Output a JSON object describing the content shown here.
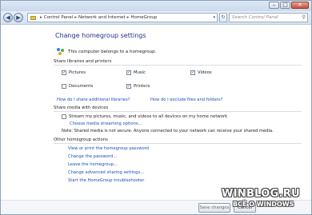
{
  "window": {
    "controls": {
      "minimize": "–",
      "maximize": "□",
      "close": "✕"
    }
  },
  "nav": {
    "back_icon": "back-arrow-icon",
    "forward_icon": "forward-arrow-icon",
    "breadcrumb": [
      "Control Panel",
      "Network and Internet",
      "HomeGroup"
    ],
    "search_placeholder": "Search Control Panel"
  },
  "page": {
    "title": "Change homegroup settings",
    "belongs_text": "This computer belongs to a homegroup."
  },
  "libraries": {
    "header": "Share libraries and printers",
    "items": [
      {
        "label": "Pictures",
        "checked": true
      },
      {
        "label": "Music",
        "checked": true
      },
      {
        "label": "Videos",
        "checked": true
      },
      {
        "label": "Documents",
        "checked": false
      },
      {
        "label": "Printers",
        "checked": true
      }
    ],
    "link_other_files": "How do I share additional libraries?",
    "link_exclude": "How do I exclude files and folders?"
  },
  "media": {
    "header": "Share media with devices",
    "stream_label": "Stream my pictures, music, and videos to all devices on my home network",
    "stream_checked": false,
    "choose_link": "Choose media streaming options...",
    "note": "Note: Shared media is not secure. Anyone connected to your network can receive your shared media."
  },
  "actions": {
    "header": "Other homegroup actions",
    "links": [
      "View or print the homegroup password",
      "Change the password...",
      "Leave the homegroup...",
      "Change advanced sharing settings...",
      "Start the HomeGroup troubleshooter"
    ]
  },
  "buttons": {
    "save": "Save changes",
    "cancel": "Cancel"
  },
  "watermark": {
    "main": "WINBLOG.RU",
    "sub": "ВСЁ О WINDOWS"
  }
}
